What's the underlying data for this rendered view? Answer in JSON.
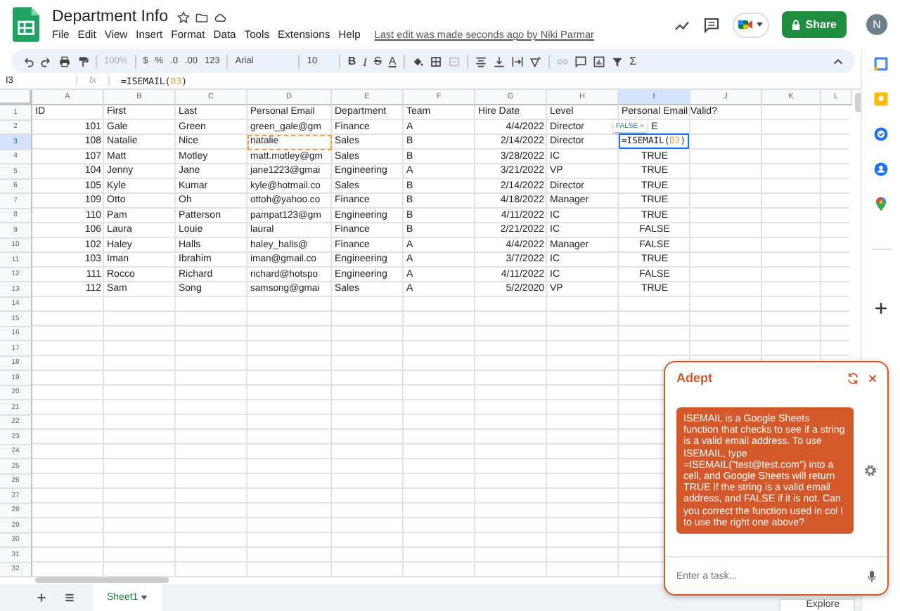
{
  "doc": {
    "title": "Department Info",
    "menu": [
      "File",
      "Edit",
      "View",
      "Insert",
      "Format",
      "Data",
      "Tools",
      "Extensions",
      "Help"
    ],
    "last_edit": "Last edit was made seconds ago by Niki Parmar",
    "share": "Share",
    "avatar": "N"
  },
  "toolbar": {
    "zoom": {
      "text": "100%",
      "disabled": true
    },
    "currency": "$",
    "percent": "%",
    "decrease_decimals": ".0",
    "increase_decimals": ".00",
    "number_format": "123",
    "font": "Arial",
    "font_size": "10",
    "bold": "B",
    "italic": "I",
    "strikethrough": "S",
    "text_color": "A",
    "functions": "Σ"
  },
  "formula_bar": {
    "name_box": "I3",
    "fx": "fx",
    "prefix": "=ISEMAIL(",
    "ref": "D3",
    "suffix": ")"
  },
  "columns": [
    {
      "label": "A",
      "selected": false
    },
    {
      "label": "B",
      "selected": false
    },
    {
      "label": "C",
      "selected": false
    },
    {
      "label": "D",
      "selected": false
    },
    {
      "label": "E",
      "selected": false
    },
    {
      "label": "F",
      "selected": false
    },
    {
      "label": "G",
      "selected": false
    },
    {
      "label": "H",
      "selected": false
    },
    {
      "label": "I",
      "selected": true
    },
    {
      "label": "J",
      "selected": false
    },
    {
      "label": "K",
      "selected": false
    },
    {
      "label": "L",
      "selected": false
    }
  ],
  "rows": [
    {
      "number": "1",
      "selected": false,
      "cells": [
        "ID",
        "First",
        "Last",
        "Personal Email",
        "Department",
        "Team",
        "Hire Date",
        "Level",
        "Personal Email Valid?"
      ]
    },
    {
      "number": "2",
      "selected": false,
      "cells": [
        "101",
        "Gale",
        "Green",
        "green_gale@gm",
        "Finance",
        "A",
        "4/4/2022",
        "Director",
        "E"
      ]
    },
    {
      "number": "3",
      "selected": true,
      "cells": [
        "108",
        "Natalie",
        "Nice",
        {
          "text": "natalie",
          "referenced": true
        },
        "Sales",
        "B",
        "2/14/2022",
        "Director",
        {
          "kind": "editor",
          "prefix": "=ISEMAIL(",
          "ref": "D3",
          "suffix": ")",
          "preview": "FALSE",
          "preview_close": "×"
        }
      ]
    },
    {
      "number": "4",
      "selected": false,
      "cells": [
        "107",
        "Matt",
        "Motley",
        "matt.motley@gm",
        "Sales",
        "B",
        "3/28/2022",
        "IC",
        "TRUE"
      ]
    },
    {
      "number": "5",
      "selected": false,
      "cells": [
        "104",
        "Jenny",
        "Jane",
        "jane1223@gmai",
        "Engineering",
        "A",
        "3/21/2022",
        "VP",
        "TRUE"
      ]
    },
    {
      "number": "6",
      "selected": false,
      "cells": [
        "105",
        "Kyle",
        "Kumar",
        "kyle@hotmail.co",
        "Sales",
        "B",
        "2/14/2022",
        "Director",
        "TRUE"
      ]
    },
    {
      "number": "7",
      "selected": false,
      "cells": [
        "109",
        "Otto",
        "Oh",
        "ottoh@yahoo.co",
        "Finance",
        "B",
        "4/18/2022",
        "Manager",
        "TRUE"
      ]
    },
    {
      "number": "8",
      "selected": false,
      "cells": [
        "110",
        "Pam",
        "Patterson",
        "pampat123@gm",
        "Engineering",
        "B",
        "4/11/2022",
        "IC",
        "TRUE"
      ]
    },
    {
      "number": "9",
      "selected": false,
      "cells": [
        "106",
        "Laura",
        "Louie",
        "laural",
        "Finance",
        "B",
        "2/21/2022",
        "IC",
        "FALSE"
      ]
    },
    {
      "number": "10",
      "selected": false,
      "cells": [
        "102",
        "Haley",
        "Halls",
        "haley_halls@",
        "Finance",
        "A",
        "4/4/2022",
        "Manager",
        "FALSE"
      ]
    },
    {
      "number": "11",
      "selected": false,
      "cells": [
        "103",
        "Iman",
        "Ibrahim",
        "iman@gmail.co",
        "Engineering",
        "A",
        "3/7/2022",
        "IC",
        "TRUE"
      ]
    },
    {
      "number": "12",
      "selected": false,
      "cells": [
        "111",
        "Rocco",
        "Richard",
        "richard@hotspo",
        "Engineering",
        "A",
        "4/11/2022",
        "IC",
        "FALSE"
      ]
    },
    {
      "number": "13",
      "selected": false,
      "cells": [
        "112",
        "Sam",
        "Song",
        "samsong@gmai",
        "Sales",
        "A",
        "5/2/2020",
        "VP",
        "TRUE"
      ]
    },
    {
      "number": "14",
      "selected": false
    },
    {
      "number": "15",
      "selected": false
    },
    {
      "number": "16",
      "selected": false
    },
    {
      "number": "17",
      "selected": false
    },
    {
      "number": "18",
      "selected": false
    },
    {
      "number": "19",
      "selected": false
    },
    {
      "number": "20",
      "selected": false
    },
    {
      "number": "21",
      "selected": false
    },
    {
      "number": "22",
      "selected": false
    },
    {
      "number": "23",
      "selected": false
    },
    {
      "number": "24",
      "selected": false
    },
    {
      "number": "25",
      "selected": false
    },
    {
      "number": "26",
      "selected": false
    },
    {
      "number": "27",
      "selected": false
    },
    {
      "number": "28",
      "selected": false
    },
    {
      "number": "29",
      "selected": false
    },
    {
      "number": "30",
      "selected": false
    },
    {
      "number": "31",
      "selected": false
    },
    {
      "number": "32",
      "selected": false
    }
  ],
  "sheets": [
    {
      "label": "Sheet1",
      "selected": true
    }
  ],
  "explore": "Explore",
  "assistant": {
    "title": "Adept",
    "message": "ISEMAIL is a Google Sheets function that checks to see if a string is a valid email address. To use ISEMAIL, type =ISEMAIL(\"test@test.com\") into a cell, and Google Sheets will return TRUE if the string is a valid email address, and FALSE if it is not. Can you correct the function used in col I to use the right one above?",
    "placeholder": "Enter a task..."
  }
}
